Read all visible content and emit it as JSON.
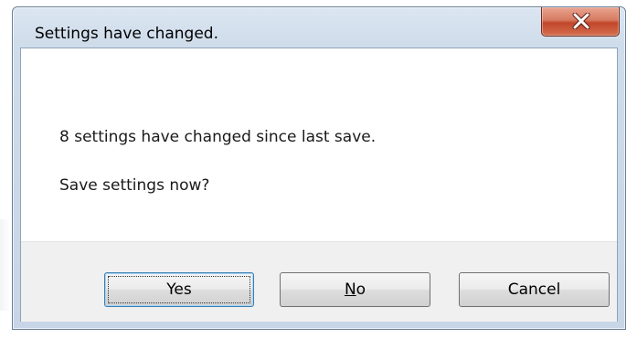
{
  "dialog": {
    "title": "Settings have changed.",
    "close_icon": "close-icon",
    "message_line1": "8 settings have changed since last save.",
    "message_line2": "Save settings now?"
  },
  "buttons": {
    "yes_label": "Yes",
    "no_mnemonic": "N",
    "no_rest": "o",
    "cancel_label": "Cancel"
  },
  "colors": {
    "close_button": "#c7492c",
    "default_button_border": "#3c7fb1",
    "button_bar": "#f0f0f0"
  }
}
